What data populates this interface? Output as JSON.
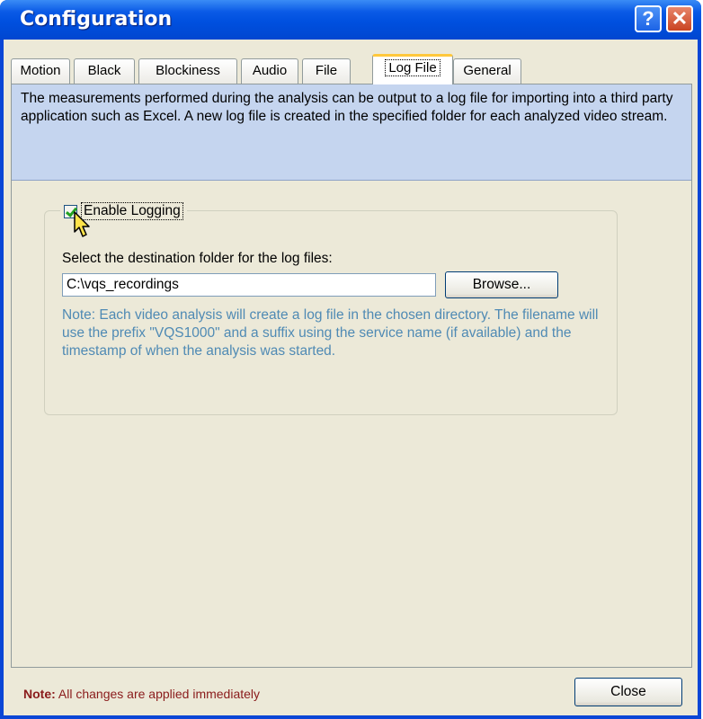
{
  "window": {
    "title": "Configuration",
    "help_glyph": "?",
    "close_glyph": "✕"
  },
  "tabs": [
    {
      "label": "Motion",
      "active": false
    },
    {
      "label": "Black",
      "active": false
    },
    {
      "label": "Blockiness",
      "active": false
    },
    {
      "label": "Audio",
      "active": false
    },
    {
      "label": "File",
      "active": false
    },
    {
      "label": "Log File",
      "active": true
    },
    {
      "label": "General",
      "active": false
    }
  ],
  "info": {
    "text": "The measurements performed during the analysis can be output to a log file for importing into a third party application such as Excel. A new log file is created in the specified folder for each analyzed video stream."
  },
  "logging": {
    "enable_label": "Enable Logging",
    "enabled": true,
    "dest_label": "Select the destination folder for the log files:",
    "path_value": "C:\\vqs_recordings",
    "browse_label": "Browse...",
    "note": "Note: Each video analysis will create a log file in the chosen directory. The filename will use the prefix \"VQS1000\" and a suffix using the service name (if available) and the timestamp of when the analysis was started."
  },
  "footer": {
    "note_bold": "Note:",
    "note_text": " All changes are applied immediately",
    "close_label": "Close"
  },
  "colors": {
    "title_bar": "#0a5ae6",
    "info_bg": "#c5d5ef",
    "note_text": "#4f8ab4",
    "footer_note": "#8a1b1b"
  }
}
